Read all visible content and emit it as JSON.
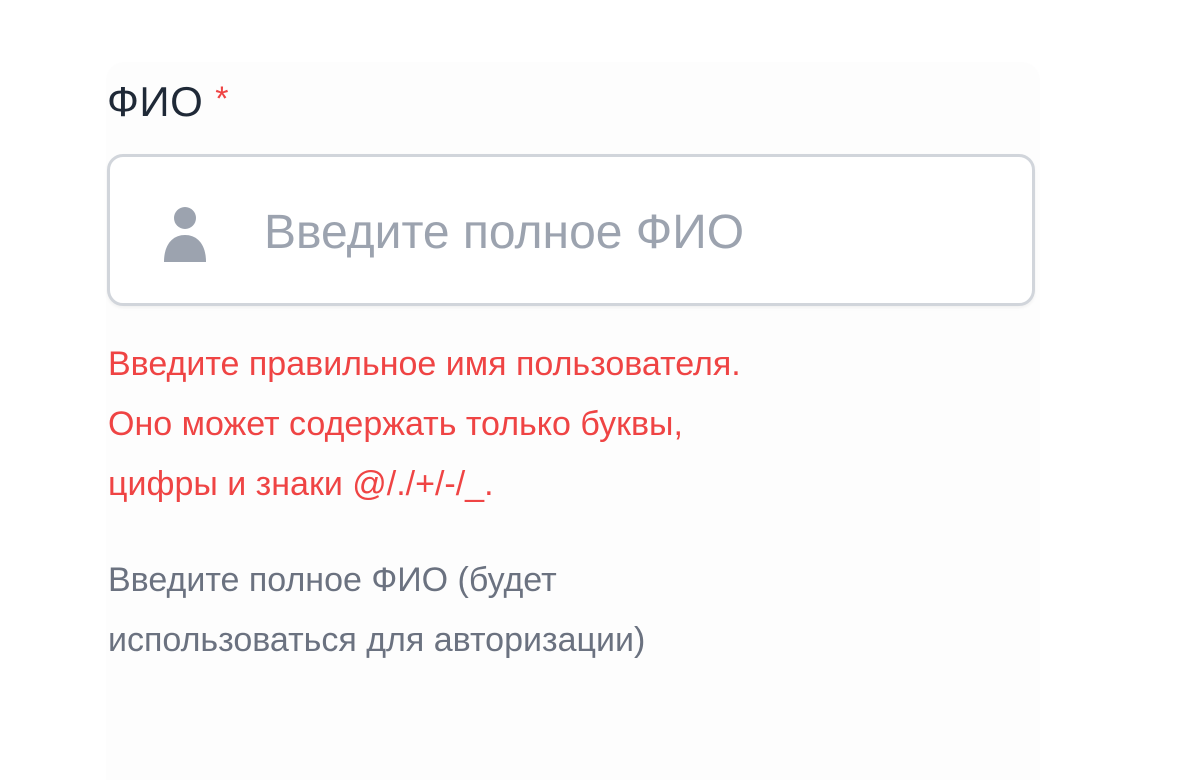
{
  "form": {
    "field": {
      "label": "ФИО",
      "required_marker": "*",
      "icon": "user-icon",
      "placeholder": "Введите полное ФИО",
      "value": "",
      "error_message": "Введите правильное имя пользователя.\nОно может содержать только буквы,\nцифры и знаки @/./+/-/_.",
      "help_text": "Введите полное ФИО (будет\nиспользоваться для авторизации)"
    }
  },
  "colors": {
    "label": "#1f2937",
    "required": "#ef4444",
    "error": "#ef4444",
    "help": "#6b7280",
    "placeholder": "#9ca3af",
    "border": "#d1d5db",
    "icon": "#9ca3af"
  }
}
